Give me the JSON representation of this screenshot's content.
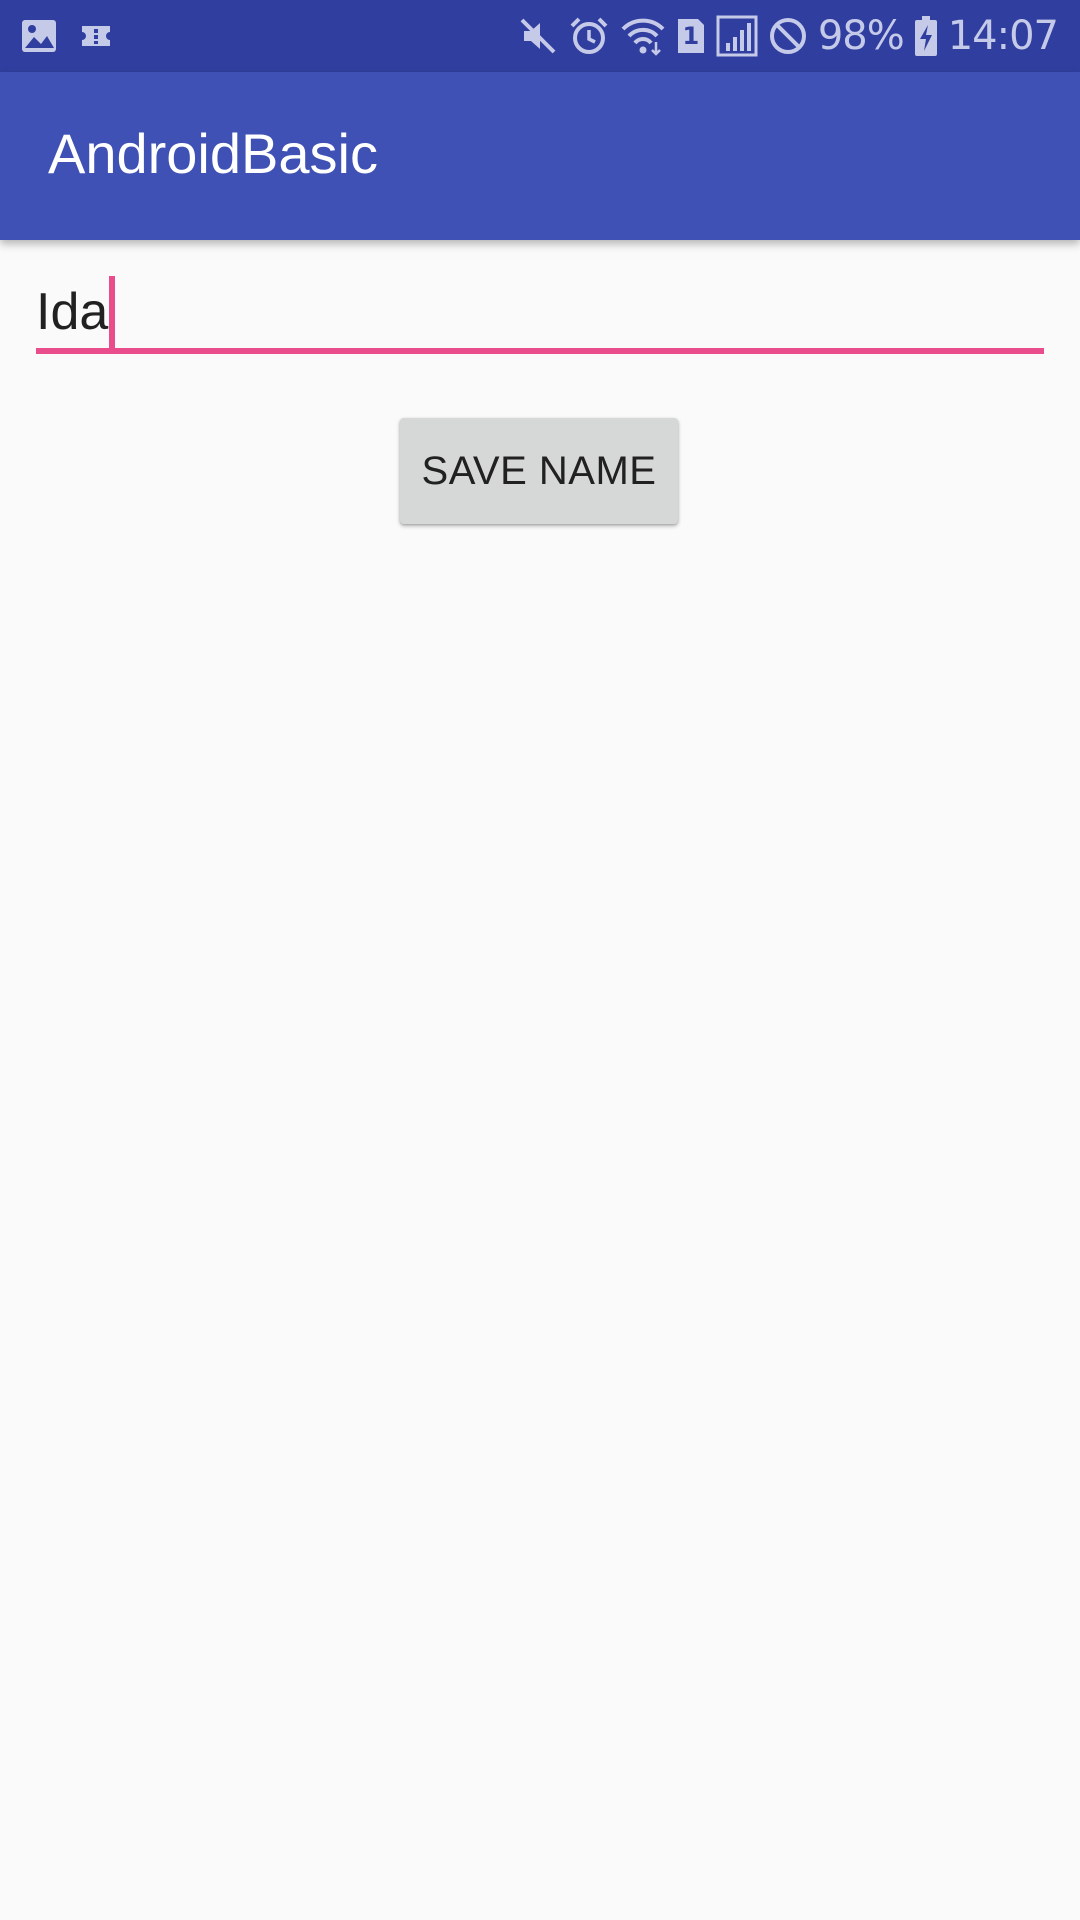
{
  "status_bar": {
    "left_icons": [
      "image-icon",
      "ticket-icon"
    ],
    "right_icons": [
      "mute-icon",
      "alarm-icon",
      "wifi-icon",
      "sim-1-icon",
      "signal-icon",
      "blocked-icon",
      "battery-charging-icon"
    ],
    "sim_label": "1",
    "battery_percent": "98%",
    "time": "14:07",
    "background_color": "#303f9f",
    "icon_color": "#c5cae9"
  },
  "app_bar": {
    "title": "AndroidBasic",
    "background_color": "#3f51b5"
  },
  "form": {
    "name_value": "Ida",
    "accent_color": "#e94d8b"
  },
  "save_button": {
    "label": "SAVE NAME"
  }
}
